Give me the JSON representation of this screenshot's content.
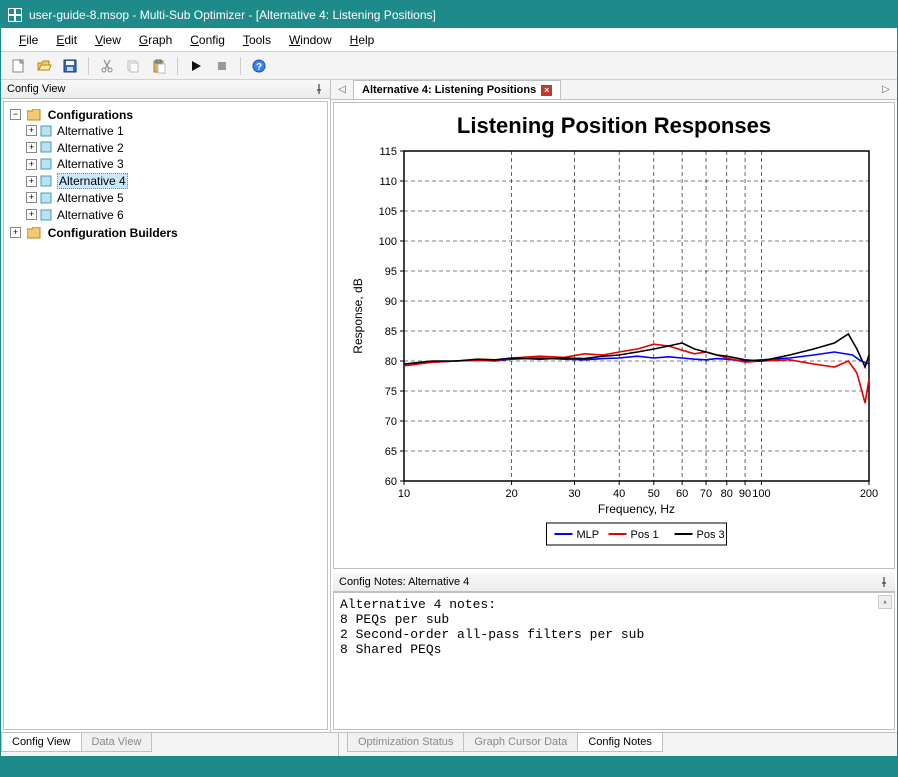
{
  "window": {
    "title": "user-guide-8.msop - Multi-Sub Optimizer - [Alternative 4: Listening Positions]"
  },
  "menubar": [
    "File",
    "Edit",
    "View",
    "Graph",
    "Config",
    "Tools",
    "Window",
    "Help"
  ],
  "toolbar_icons": [
    "new",
    "open",
    "save",
    "cut",
    "copy",
    "paste",
    "run",
    "stop",
    "help"
  ],
  "left_pane": {
    "title": "Config View",
    "tree": {
      "root1": {
        "label": "Configurations",
        "expanded": true
      },
      "alts": [
        {
          "label": "Alternative 1"
        },
        {
          "label": "Alternative 2"
        },
        {
          "label": "Alternative 3"
        },
        {
          "label": "Alternative 4",
          "selected": true
        },
        {
          "label": "Alternative 5"
        },
        {
          "label": "Alternative 6"
        }
      ],
      "root2": {
        "label": "Configuration Builders",
        "expanded": false
      }
    }
  },
  "right_pane": {
    "tab_label": "Alternative 4: Listening Positions",
    "config_notes_header": "Config Notes: Alternative 4",
    "config_notes_body": "Alternative 4 notes:\n8 PEQs per sub\n2 Second-order all-pass filters per sub\n8 Shared PEQs"
  },
  "bottom_tabs_left": [
    {
      "label": "Config View",
      "active": true
    },
    {
      "label": "Data View",
      "active": false
    }
  ],
  "bottom_tabs_right": [
    {
      "label": "Optimization Status",
      "active": false
    },
    {
      "label": "Graph Cursor Data",
      "active": false
    },
    {
      "label": "Config Notes",
      "active": true
    }
  ],
  "chart_data": {
    "type": "line",
    "title": "Listening Position Responses",
    "xlabel": "Frequency, Hz",
    "ylabel": "Response, dB",
    "xscale": "log",
    "xlim": [
      10,
      200
    ],
    "ylim": [
      60,
      115
    ],
    "xticks": [
      10,
      20,
      30,
      40,
      50,
      60,
      70,
      80,
      90,
      100,
      200
    ],
    "yticks": [
      60,
      65,
      70,
      75,
      80,
      85,
      90,
      95,
      100,
      105,
      110,
      115
    ],
    "legend_position": "bottom",
    "series": [
      {
        "name": "MLP",
        "color": "#0000ff",
        "x": [
          10,
          12,
          14,
          16,
          18,
          20,
          24,
          28,
          32,
          36,
          40,
          45,
          50,
          55,
          60,
          65,
          70,
          75,
          80,
          90,
          100,
          120,
          140,
          160,
          180,
          190,
          200
        ],
        "y": [
          79.5,
          79.8,
          80,
          80.2,
          80,
          80.3,
          80.5,
          80.3,
          80.2,
          80.4,
          80.5,
          80.8,
          80.5,
          80.7,
          80.5,
          80.3,
          80.2,
          80.4,
          80.3,
          80,
          80.2,
          80.5,
          81,
          81.5,
          81,
          80,
          79.5
        ]
      },
      {
        "name": "Pos 1",
        "color": "#e60000",
        "x": [
          10,
          12,
          14,
          16,
          18,
          20,
          24,
          28,
          32,
          36,
          40,
          45,
          50,
          55,
          60,
          65,
          70,
          75,
          80,
          90,
          100,
          120,
          140,
          160,
          175,
          185,
          195,
          200
        ],
        "y": [
          79.2,
          79.8,
          80,
          80.1,
          80,
          80.5,
          80.8,
          80.6,
          81.2,
          81,
          81.5,
          82,
          82.8,
          82.5,
          81.8,
          81.2,
          81.5,
          81,
          80.5,
          79.8,
          80,
          80.2,
          79.5,
          79,
          80,
          78,
          73,
          77
        ]
      },
      {
        "name": "Pos 3",
        "color": "#000000",
        "x": [
          10,
          12,
          14,
          16,
          18,
          20,
          24,
          28,
          32,
          36,
          40,
          45,
          50,
          55,
          60,
          65,
          70,
          75,
          80,
          90,
          100,
          120,
          140,
          160,
          175,
          185,
          195,
          200
        ],
        "y": [
          79.5,
          80,
          80,
          80.3,
          80.2,
          80.5,
          80.3,
          80.5,
          80.4,
          80.8,
          81,
          81.5,
          82,
          82.5,
          83,
          82,
          81.5,
          81,
          80.8,
          80.2,
          80,
          81,
          82,
          83,
          84.5,
          82,
          79,
          81
        ]
      }
    ]
  }
}
